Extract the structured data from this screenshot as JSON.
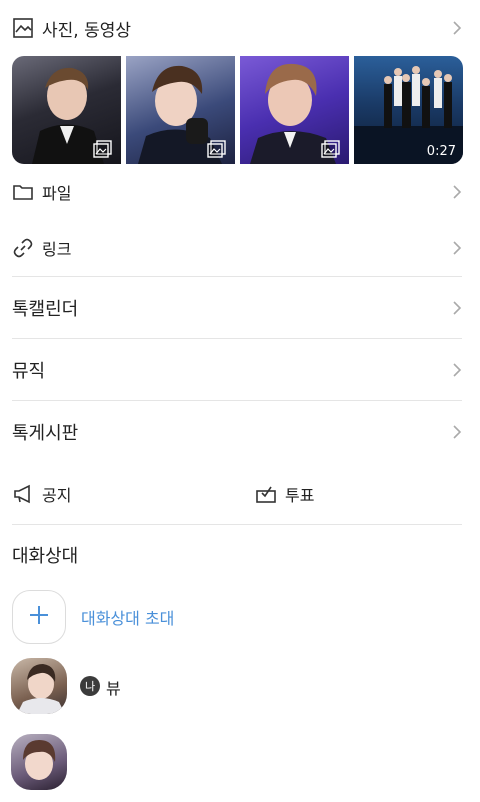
{
  "photos_section": {
    "label": "사진, 동영상",
    "icon": "image-icon",
    "thumbnails": [
      {
        "type": "photo",
        "badge_icon": "gallery-icon"
      },
      {
        "type": "photo",
        "badge_icon": "gallery-icon"
      },
      {
        "type": "photo",
        "badge_icon": "gallery-icon"
      },
      {
        "type": "video",
        "duration": "0:27"
      }
    ]
  },
  "files": {
    "label": "파일",
    "icon": "folder-icon"
  },
  "links": {
    "label": "링크",
    "icon": "link-icon"
  },
  "menu": [
    {
      "label": "톡캘린더"
    },
    {
      "label": "뮤직"
    },
    {
      "label": "톡게시판"
    }
  ],
  "notice": {
    "label": "공지",
    "icon": "megaphone-icon"
  },
  "vote": {
    "label": "투표",
    "icon": "vote-box-icon"
  },
  "participants": {
    "title": "대화상대",
    "invite_label": "대화상대 초대",
    "members": [
      {
        "name": "뷰",
        "me_badge": "나"
      },
      {
        "name": ""
      }
    ]
  },
  "colors": {
    "accent": "#4a90d9",
    "divider": "#e5e5e5",
    "text": "#222222"
  }
}
